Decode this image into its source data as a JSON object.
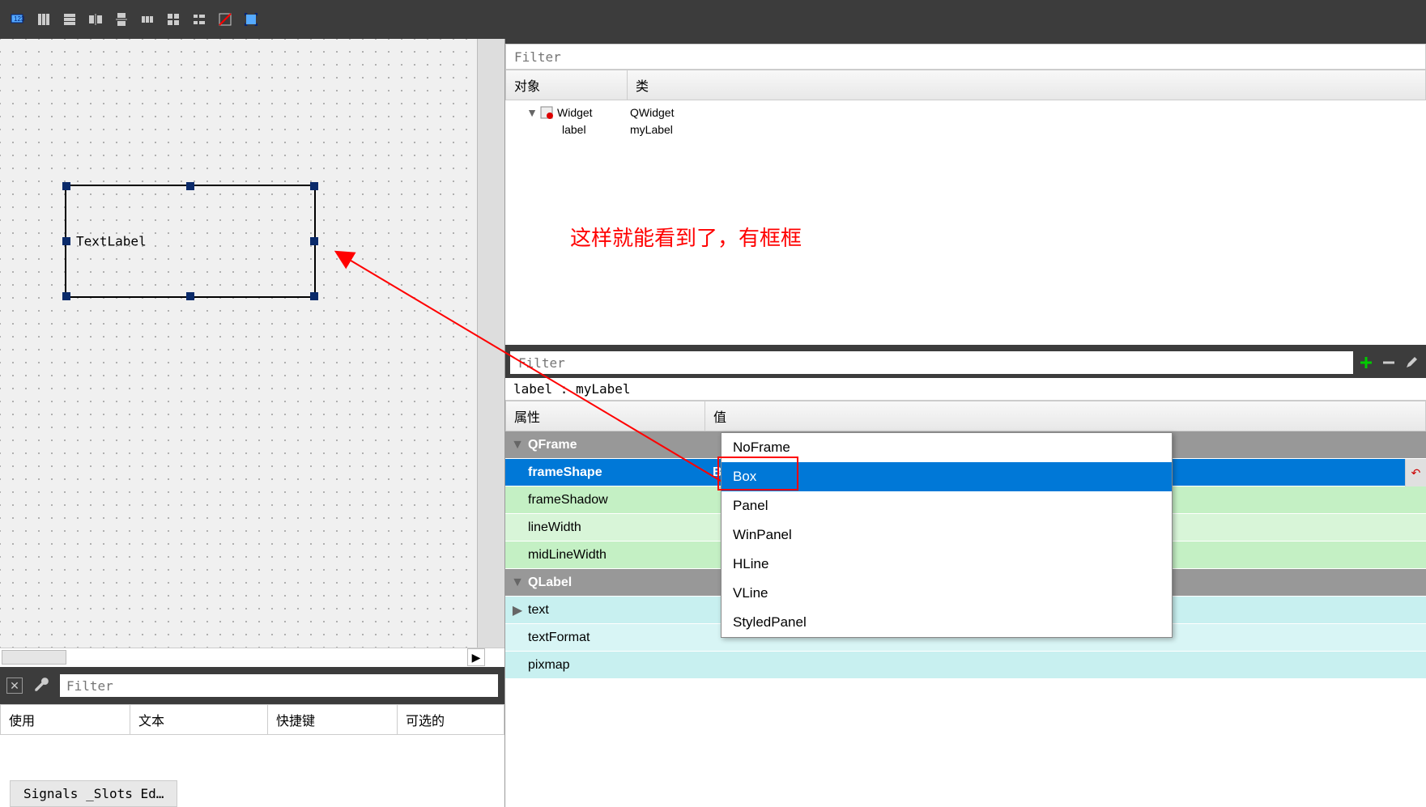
{
  "toolbar_icons": [
    "tab-order",
    "grid-h",
    "grid-rows",
    "layout-h",
    "layout-v",
    "layout-hs",
    "layout-vs",
    "layout-grid",
    "layout-form",
    "break",
    "adjust"
  ],
  "design": {
    "label_text": "TextLabel"
  },
  "obj_filter": "Filter",
  "obj_header": {
    "c1": "对象",
    "c2": "类"
  },
  "obj_tree": [
    {
      "name": "Widget",
      "cls": "QWidget",
      "indent": 0,
      "expand": true,
      "icon": "widget"
    },
    {
      "name": "label",
      "cls": "myLabel",
      "indent": 1,
      "expand": false,
      "icon": ""
    }
  ],
  "annotation": "这样就能看到了，有框框",
  "prop_filter": "Filter",
  "prop_label": "label : myLabel",
  "prop_header": {
    "c1": "属性",
    "c2": "值"
  },
  "prop_rows": [
    {
      "type": "group",
      "name": "QFrame",
      "exp": "▼"
    },
    {
      "type": "selected",
      "name": "frameShape",
      "val": "Box"
    },
    {
      "type": "green",
      "name": "frameShadow",
      "val": ""
    },
    {
      "type": "green2",
      "name": "lineWidth",
      "val": ""
    },
    {
      "type": "green",
      "name": "midLineWidth",
      "val": ""
    },
    {
      "type": "group",
      "name": "QLabel",
      "exp": "▼"
    },
    {
      "type": "cyan",
      "name": "text",
      "val": "",
      "exp": "▶"
    },
    {
      "type": "cyan2",
      "name": "textFormat",
      "val": ""
    },
    {
      "type": "cyan",
      "name": "pixmap",
      "val": ""
    }
  ],
  "dropdown": [
    "NoFrame",
    "Box",
    "Panel",
    "WinPanel",
    "HLine",
    "VLine",
    "StyledPanel"
  ],
  "dropdown_sel": "Box",
  "signals": {
    "filter": "Filter",
    "cols": {
      "c1": "使用",
      "c2": "文本",
      "c3": "快捷键",
      "c4": "可选的"
    },
    "tab": "Signals _Slots Ed…"
  }
}
